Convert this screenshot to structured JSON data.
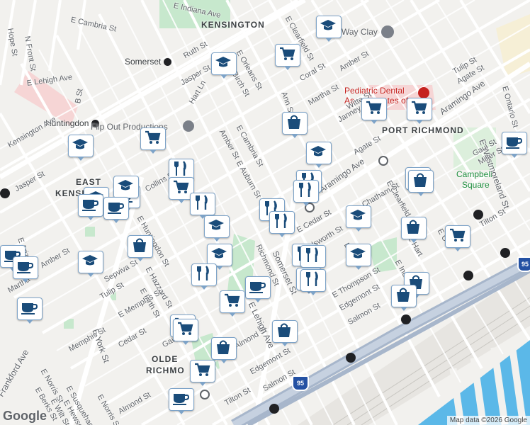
{
  "places": {
    "kensington": "KENSINGTON",
    "port_richmond": "PORT RICHMOND",
    "east_kensington_1": "EAST",
    "east_kensington_2": "KENSI",
    "olde_richmond_1": "OLDE",
    "olde_richmond_2": "RICHMO",
    "somerset": "Somerset",
    "huntingdon": "Huntingdon",
    "campbell_square_1": "Campbell",
    "campbell_square_2": "Square"
  },
  "pois": {
    "pediatric_1": "Pediatric Dental",
    "pediatric_2": "As",
    "pediatric_3": "ates of",
    "flip_out": "Flip Out Productions",
    "clay": "Way Clay"
  },
  "streets": {
    "e_indiana": "E Indiana Ave",
    "e_cambria_top": "E Cambria St",
    "hope": "Hope St",
    "n_front": "N Front St",
    "e_lehigh": "E Lehigh Ave",
    "kensington_ave": "Kensington Ave",
    "b_st": "B St",
    "jasper_left": "Jasper St",
    "e_arizona": "E Arizona St",
    "amber_left": "Amber St",
    "martha_left": "Martha St",
    "ruth": "Ruth St",
    "jasper_mid": "Jasper St",
    "hart_ln": "Hart Ln",
    "e_orleans": "E Orleans St",
    "birch": "Birch St",
    "e_clearfield": "E Clearfield St",
    "coral": "Coral St",
    "amber_mid": "Amber St",
    "ann": "Ann St",
    "e_cambria_mid": "E Cambria St",
    "amber_center": "Amber St",
    "e_auburn": "E Auburn St",
    "martha_mid": "Martha St",
    "witte": "Witte St",
    "janney": "Janney St",
    "tulip_right": "Tulip St",
    "agate_right": "Agate St",
    "aramingo_top": "Aramingo Ave",
    "e_ontario": "E Ontario St",
    "e_westmoreland": "E Westmoreland St",
    "agate_mid": "Agate St",
    "aramingo_mid": "Aramingo Ave",
    "gaul": "Gaul St",
    "miller": "Miller St",
    "e_clearfield_low": "E Clearfield St",
    "tilton_right": "Tilton St",
    "e_cedar": "E Cedar St",
    "e_huntingdon": "E Huntingdon St",
    "collins": "Collins St",
    "e_hazzard": "E Hazzard St",
    "e_firth": "E Firth St",
    "sepviva": "Sepviva St",
    "tulip_left": "Tulip St",
    "e_memphis": "E Memphis St",
    "e_york": "E York St",
    "cedar_left": "Cedar St",
    "memphis_low": "Memphis St",
    "e_norris": "E Norris St",
    "e_berks": "E Berks St",
    "e_wilt": "E Wilt St",
    "e_susquehanna": "E Susquehanna St",
    "e_hewson": "E Hewson St",
    "e_norris_low": "E Norris St",
    "almond_low": "Almond St",
    "frankford_ave": "Frankford Ave",
    "almond_mid": "Almond St",
    "e_thompson": "E Thompson St",
    "edgemont_mid": "Edgemont St",
    "salmon_mid": "Salmon St",
    "edgemont_low": "Edgemont St",
    "salmon_low": "Salmon St",
    "tilton_low": "Tilton St",
    "gaul_low": "Gaul St",
    "somerset_st": "Somerset St",
    "richmond_st": "Richmond St",
    "e_lehigh_low": "E Lehigh Ave",
    "chatham": "Chatham St",
    "dsworth": "dsworth St",
    "e_mont": "E Mo",
    "e_indiana_low": "E India",
    "e_hart": "E Hart",
    "e_c": "E C"
  },
  "highway": {
    "i95_a": "95",
    "i95_b": "95"
  },
  "attribution": "Map data ©2026 Google",
  "logo": "Google",
  "colors": {
    "land": "#f2f1ee",
    "road": "#ffffff",
    "highway": "#a7b6cb",
    "water": "#5bb8e8",
    "park": "#c7e8cd",
    "poi_red": "#c5221f",
    "marker_fill": "#1a4c7a"
  },
  "markers": [
    {
      "id": "school-icon",
      "kind": "school"
    },
    {
      "id": "shopping-cart-icon",
      "kind": "cart"
    },
    {
      "id": "restaurant-icon",
      "kind": "fork"
    },
    {
      "id": "coffee-icon",
      "kind": "coffee"
    },
    {
      "id": "shopping-bag-icon",
      "kind": "bag"
    }
  ]
}
